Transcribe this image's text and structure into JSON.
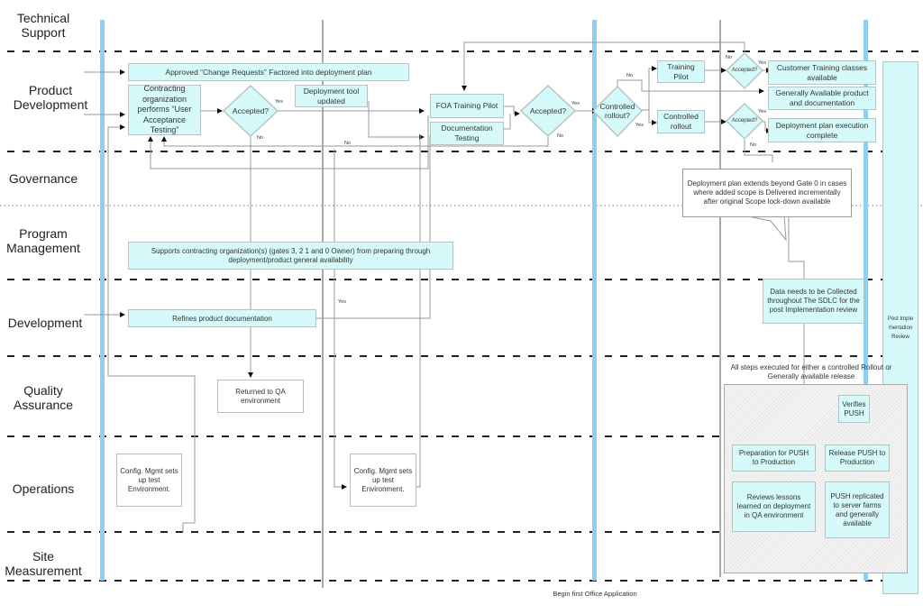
{
  "lanes": [
    {
      "name": "Technical Support"
    },
    {
      "name": "Product Development"
    },
    {
      "name": "Governance"
    },
    {
      "name": "Program Management"
    },
    {
      "name": "Development"
    },
    {
      "name": "Quality Assurance"
    },
    {
      "name": "Operations"
    },
    {
      "name": "Site Measurement"
    }
  ],
  "lane_labels": {
    "technical_support": "Technical Support",
    "product_development": "Product Development",
    "governance": "Governance",
    "program_management": "Program Management",
    "development": "Development",
    "quality_assurance": "Quality Assurance",
    "operations": "Operations",
    "site_measurement": "Site Measurement"
  },
  "nodes": {
    "change_requests": "Approved “Change Requests” Factored into deployment plan",
    "uat": "Contracting organization performs “User Acceptance Testing”",
    "accepted_1": "Accepted?",
    "deployment_tool": "Deployment tool updated",
    "foa_training": "FOA Training Pilot",
    "doc_testing": "Documentation Testing",
    "accepted_2": "Accepted?",
    "controlled_rollout_q": "Controlled rollout?",
    "training_pilot": "Training Pilot",
    "controlled_rollout": "Controlled rollout",
    "accepted_3": "Accepted?",
    "accepted_4": "Accepted?",
    "customer_training": "Customer Training classes available",
    "generally_available": "Generally Available product and documentation",
    "deployment_complete": "Deployment plan execution complete",
    "callout": "Deployment plan extends beyond Gate 0 in cases where added scope is Delivered incrementally after original Scope lock-down available",
    "supports": "Supports contracting organization(s) (gates 3, 2 1 and 0 Owner) from preparing through deployment/product general availability",
    "refines_docs": "Refines product documentation",
    "data_collected": "Data needs to be Collected throughout The SDLC for the post Implementation review",
    "post_impl": "Post Imple mentation Review",
    "returned_qa": "Returned to QA environment",
    "config_1": "Config. Mgmt sets up test Environment.",
    "config_2": "Config. Mgmt sets up test Environment.",
    "all_steps": "All steps executed for either a controlled Rollout or Generally available release",
    "verifies_push": "Verifies PUSH",
    "prep_push": "Preparation for PUSH to Production",
    "release_push": "Release PUSH to Production",
    "reviews_lessons": "Reviews lessons learned on deployment in QA environment",
    "push_replicated": "PUSH replicated to server farms and generally available",
    "begin_office": "Begin first Office Application"
  },
  "edge_labels": {
    "yes": "Yes",
    "no": "No"
  },
  "colors": {
    "box_fill": "#d6fafa",
    "milestone_bar": "#8ecff5",
    "connector": "#aaaaaa"
  }
}
